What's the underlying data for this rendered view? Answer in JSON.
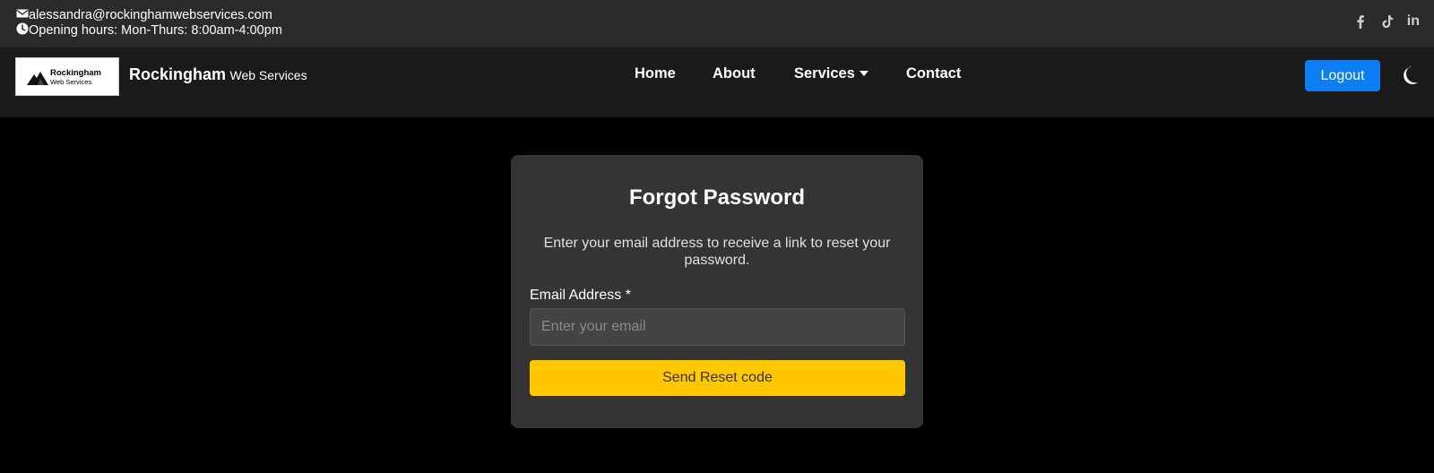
{
  "topbar": {
    "email": "alessandra@rockinghamwebservices.com",
    "hours": "Opening hours: Mon-Thurs: 8:00am-4:00pm",
    "social_icons": [
      "facebook-icon",
      "tiktok-icon",
      "linkedin-icon"
    ],
    "linkedin_text": "in"
  },
  "navbar": {
    "logo": {
      "name": "Rockingham",
      "sub": "Web Services"
    },
    "brand_main": "Rockingham",
    "brand_sub": "Web Services",
    "links": {
      "home": "Home",
      "about": "About",
      "services": "Services",
      "contact": "Contact"
    },
    "logout_label": "Logout",
    "theme_icon": "moon-icon"
  },
  "form": {
    "title": "Forgot Password",
    "description": "Enter your email address to receive a link to reset your password.",
    "email_label": "Email Address *",
    "email_value": "",
    "email_placeholder": "Enter your email",
    "submit_label": "Send Reset code"
  },
  "colors": {
    "accent_blue": "#0d7df4",
    "accent_yellow": "#ffc800",
    "card_bg": "#343434",
    "topbar_bg": "#2b2b2b",
    "navbar_bg": "#1a1a1a",
    "page_bg": "#000000"
  }
}
